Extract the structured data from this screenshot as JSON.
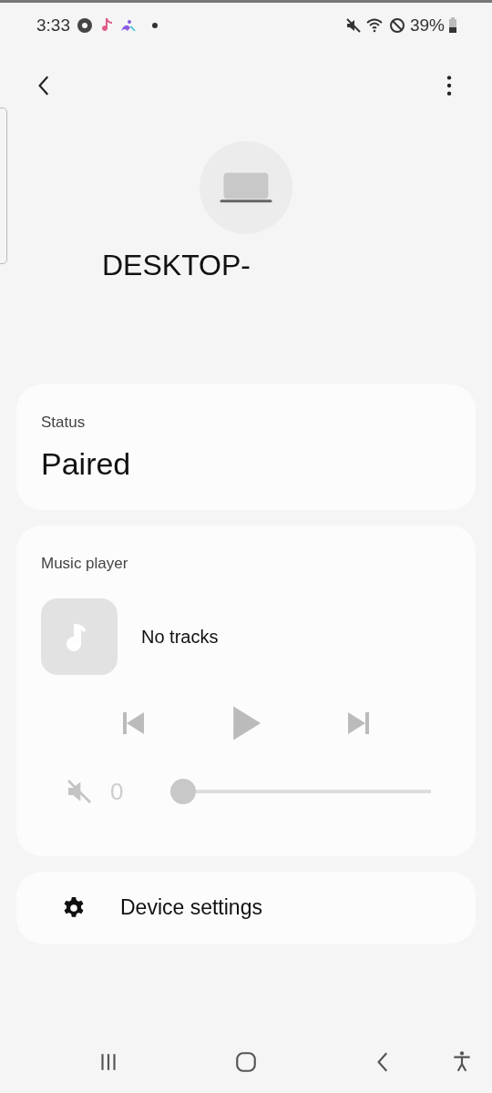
{
  "status_bar": {
    "time": "3:33",
    "battery": "39%"
  },
  "device": {
    "name": "DESKTOP-"
  },
  "status_card": {
    "label": "Status",
    "value": "Paired"
  },
  "music_player": {
    "label": "Music player",
    "track": "No tracks",
    "volume": {
      "muted": true,
      "reading": "0",
      "level": 0
    }
  },
  "settings_item": {
    "label": "Device settings"
  }
}
